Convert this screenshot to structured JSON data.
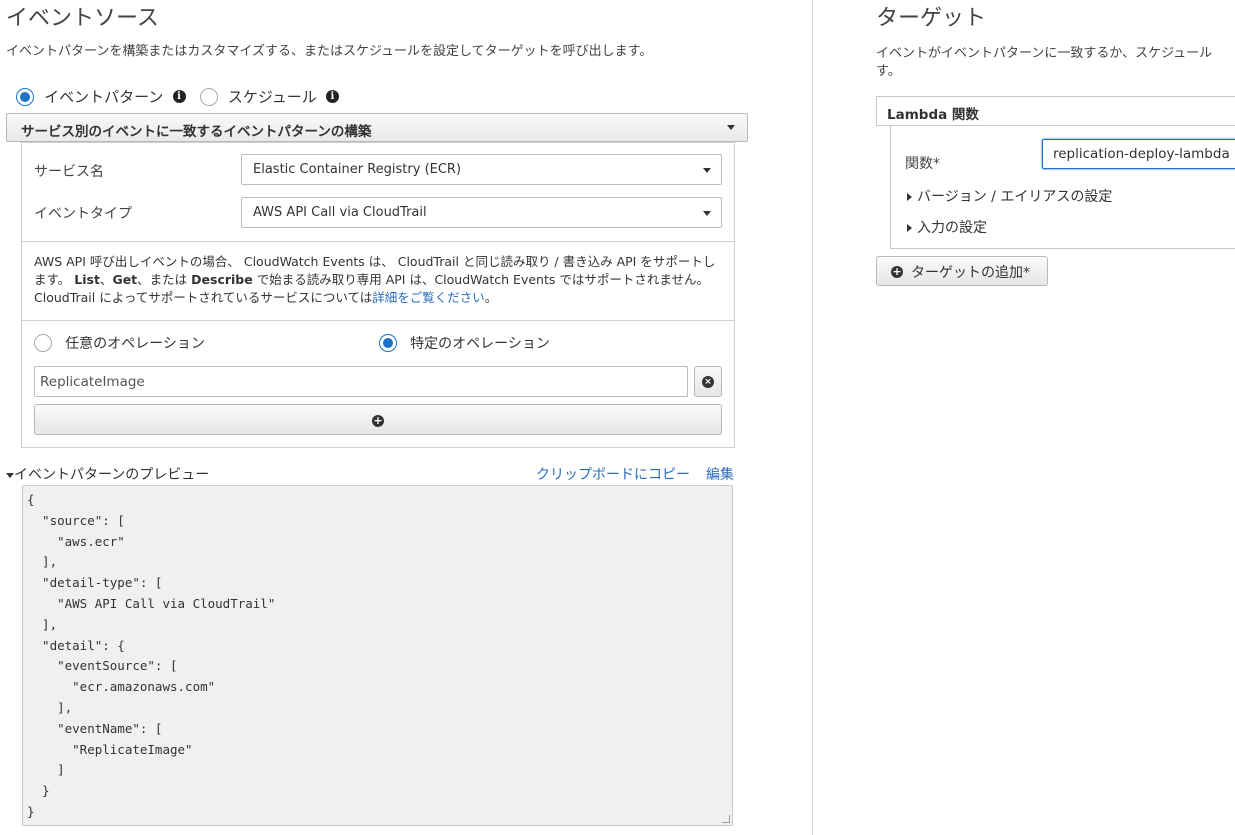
{
  "event_source": {
    "title": "イベントソース",
    "description": "イベントパターンを構築またはカスタマイズする、またはスケジュールを設定してターゲットを呼び出します。",
    "radio_event_pattern": "イベントパターン",
    "radio_schedule": "スケジュール",
    "builder_header": "サービス別のイベントに一致するイベントパターンの構築",
    "service_name_label": "サービス名",
    "service_name_value": "Elastic Container Registry (ECR)",
    "event_type_label": "イベントタイプ",
    "event_type_value": "AWS API Call via CloudTrail",
    "info_line1": "AWS API 呼び出しイベントの場合、 CloudWatch Events は、 CloudTrail と同じ読み取り / 書き込み API をサポートし",
    "info_line2_pre": "ます。",
    "info_line2_list": "List",
    "info_line2_sep1": "、",
    "info_line2_get": "Get",
    "info_line2_sep2": "、または",
    "info_line2_describe": "Describe",
    "info_line2_post": "で始まる読み取り専用 API は、CloudWatch Events ではサポートされません。",
    "info_line3_pre": "CloudTrail によってサポートされているサービスについては",
    "info_line3_link": "詳細をご覧ください",
    "info_line3_post": "。",
    "any_operation": "任意のオペレーション",
    "specific_operation": "特定のオペレーション",
    "operation_value": "ReplicateImage",
    "preview_label": "イベントパターンのプレビュー",
    "copy_link": "クリップボードにコピー",
    "edit_link": "編集",
    "preview_code": "{\n  \"source\": [\n    \"aws.ecr\"\n  ],\n  \"detail-type\": [\n    \"AWS API Call via CloudTrail\"\n  ],\n  \"detail\": {\n    \"eventSource\": [\n      \"ecr.amazonaws.com\"\n    ],\n    \"eventName\": [\n      \"ReplicateImage\"\n    ]\n  }\n}"
  },
  "target": {
    "title": "ターゲット",
    "description_line1": "イベントがイベントパターンに一致するか、スケジュール",
    "description_line2": "す。",
    "panel_title": "Lambda 関数",
    "function_label": "関数*",
    "function_value": "replication-deploy-lambda",
    "version_alias": "バージョン / エイリアスの設定",
    "input_settings": "入力の設定",
    "add_target": "ターゲットの追加*"
  },
  "colors": {
    "accent": "#1a73c8",
    "link": "#2a6ebb"
  }
}
